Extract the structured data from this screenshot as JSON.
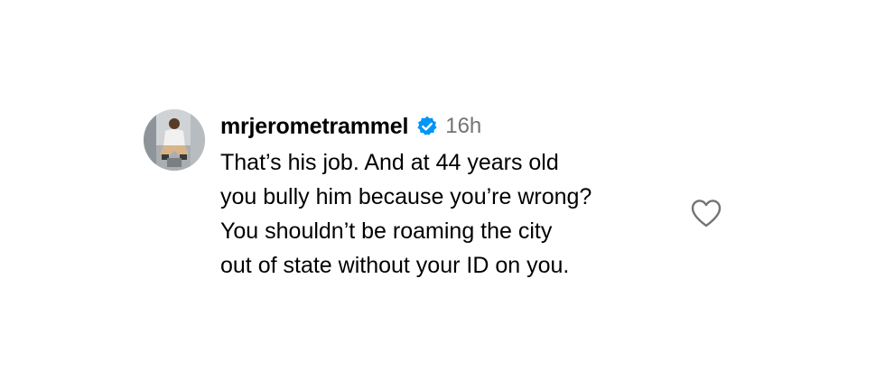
{
  "comment": {
    "username": "mrjerometrammel",
    "verified": true,
    "timestamp": "16h",
    "text": "That’s his job. And at 44 years old\nyou bully him because you’re wrong?\nYou shouldn’t be roaming the city\nout of state without your ID on you.",
    "avatar_icon": "profile-photo",
    "verified_icon": "verified-badge-icon",
    "like_icon": "heart-outline-icon"
  },
  "colors": {
    "background": "#ffffff",
    "text": "#000000",
    "muted": "#737373",
    "verified_blue": "#0095f6"
  }
}
